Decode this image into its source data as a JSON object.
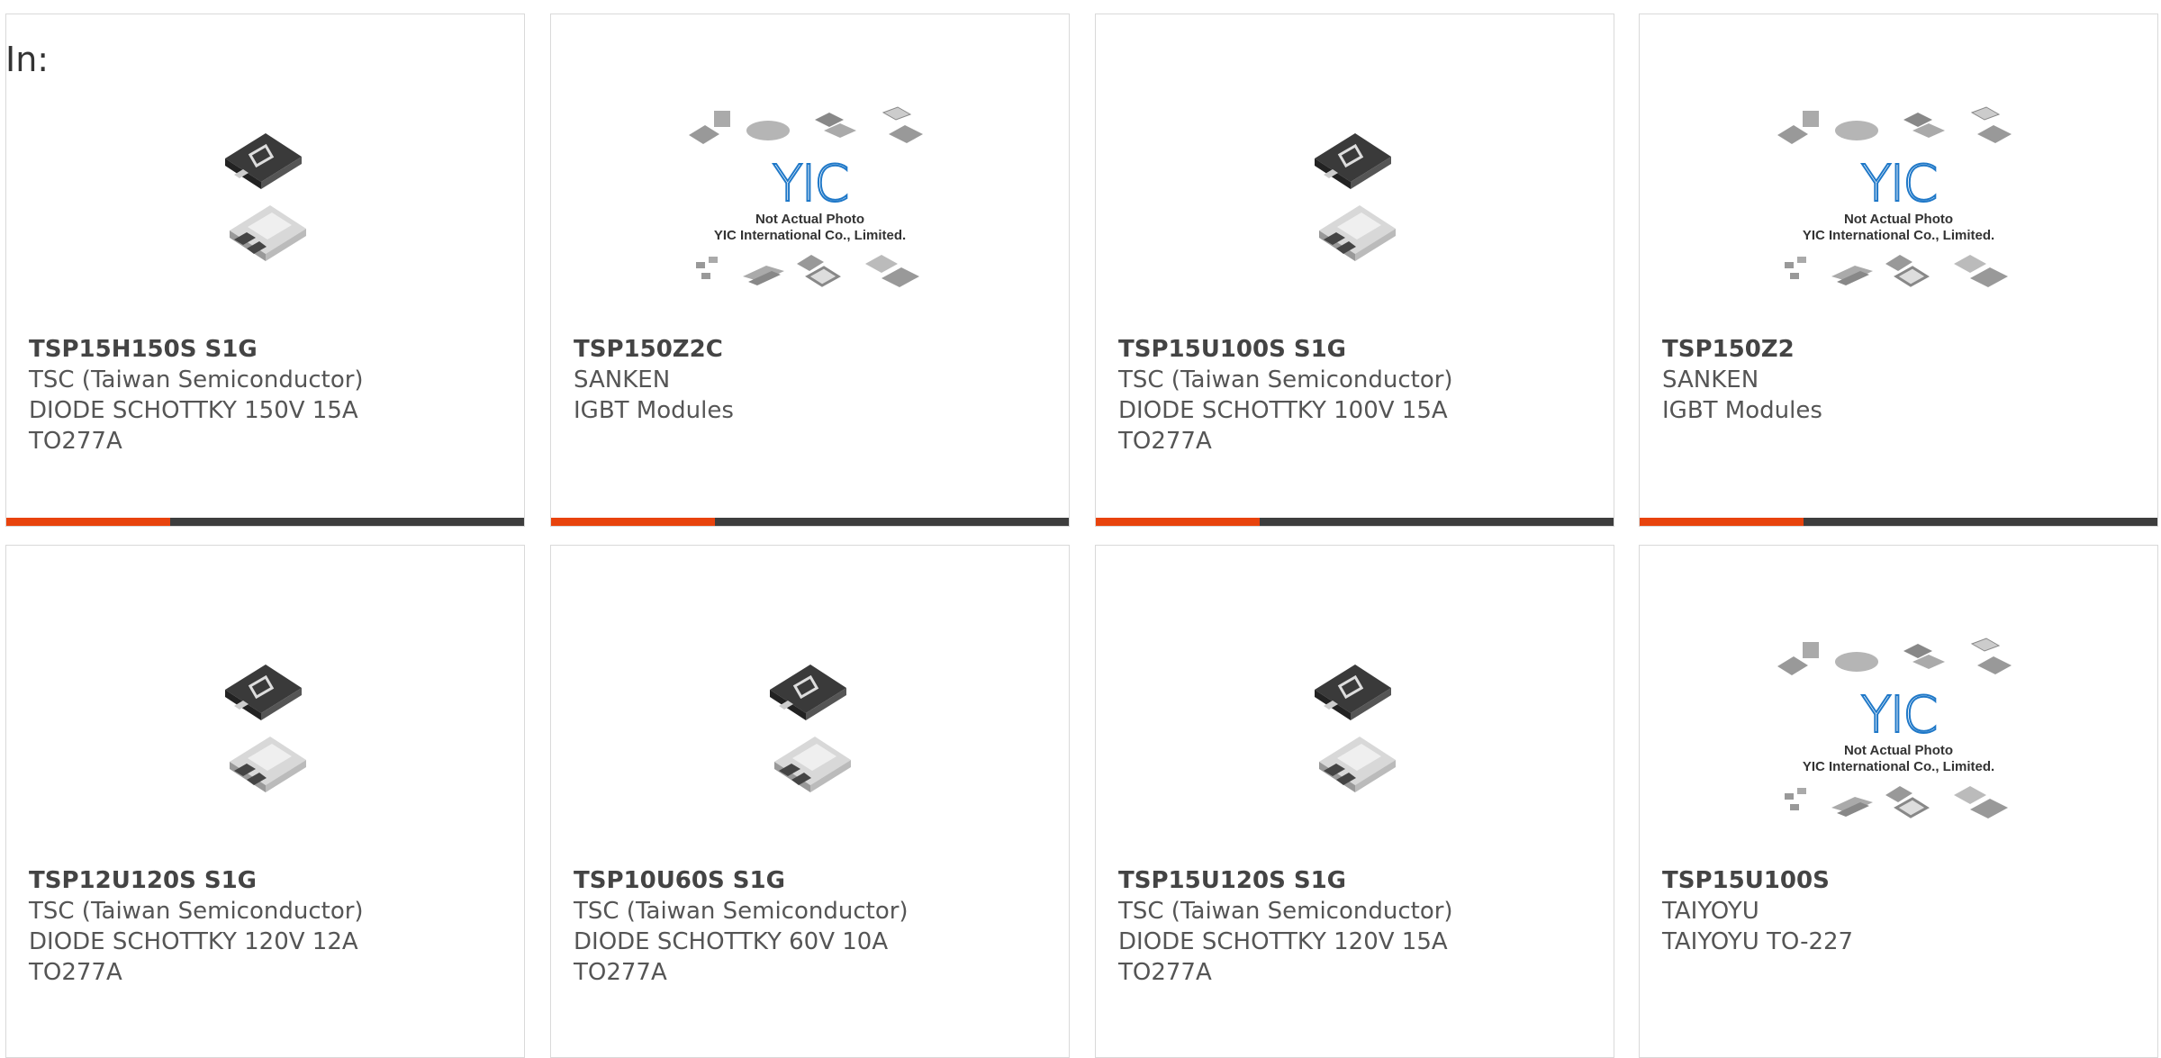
{
  "header": {
    "label": "In:"
  },
  "theme": {
    "accent": "#e8430d",
    "bar": "#3d3d3d",
    "border": "#d9d9d9"
  },
  "placeholder_photo": {
    "logo": "YIC",
    "line1": "Not Actual Photo",
    "line2": "YIC International Co., Limited."
  },
  "products": [
    {
      "part": "TSP15H150S S1G",
      "maker": "TSC (Taiwan Semiconductor)",
      "desc": "DIODE SCHOTTKY 150V 15A",
      "pkg": "TO277A",
      "image": "to277a-diode"
    },
    {
      "part": "TSP150Z2C",
      "maker": "SANKEN",
      "desc": "IGBT Modules",
      "pkg": "",
      "image": "yic-placeholder"
    },
    {
      "part": "TSP15U100S S1G",
      "maker": "TSC (Taiwan Semiconductor)",
      "desc": "DIODE SCHOTTKY 100V 15A",
      "pkg": "TO277A",
      "image": "to277a-diode"
    },
    {
      "part": "TSP150Z2",
      "maker": "SANKEN",
      "desc": "IGBT Modules",
      "pkg": "",
      "image": "yic-placeholder"
    },
    {
      "part": "TSP12U120S S1G",
      "maker": "TSC (Taiwan Semiconductor)",
      "desc": "DIODE SCHOTTKY 120V 12A",
      "pkg": "TO277A",
      "image": "to277a-diode"
    },
    {
      "part": "TSP10U60S S1G",
      "maker": "TSC (Taiwan Semiconductor)",
      "desc": "DIODE SCHOTTKY 60V 10A",
      "pkg": "TO277A",
      "image": "to277a-diode"
    },
    {
      "part": "TSP15U120S S1G",
      "maker": "TSC (Taiwan Semiconductor)",
      "desc": "DIODE SCHOTTKY 120V 15A",
      "pkg": "TO277A",
      "image": "to277a-diode"
    },
    {
      "part": "TSP15U100S",
      "maker": "TAIYOYU",
      "desc": "TAIYOYU TO-227",
      "pkg": "",
      "image": "yic-placeholder"
    }
  ]
}
